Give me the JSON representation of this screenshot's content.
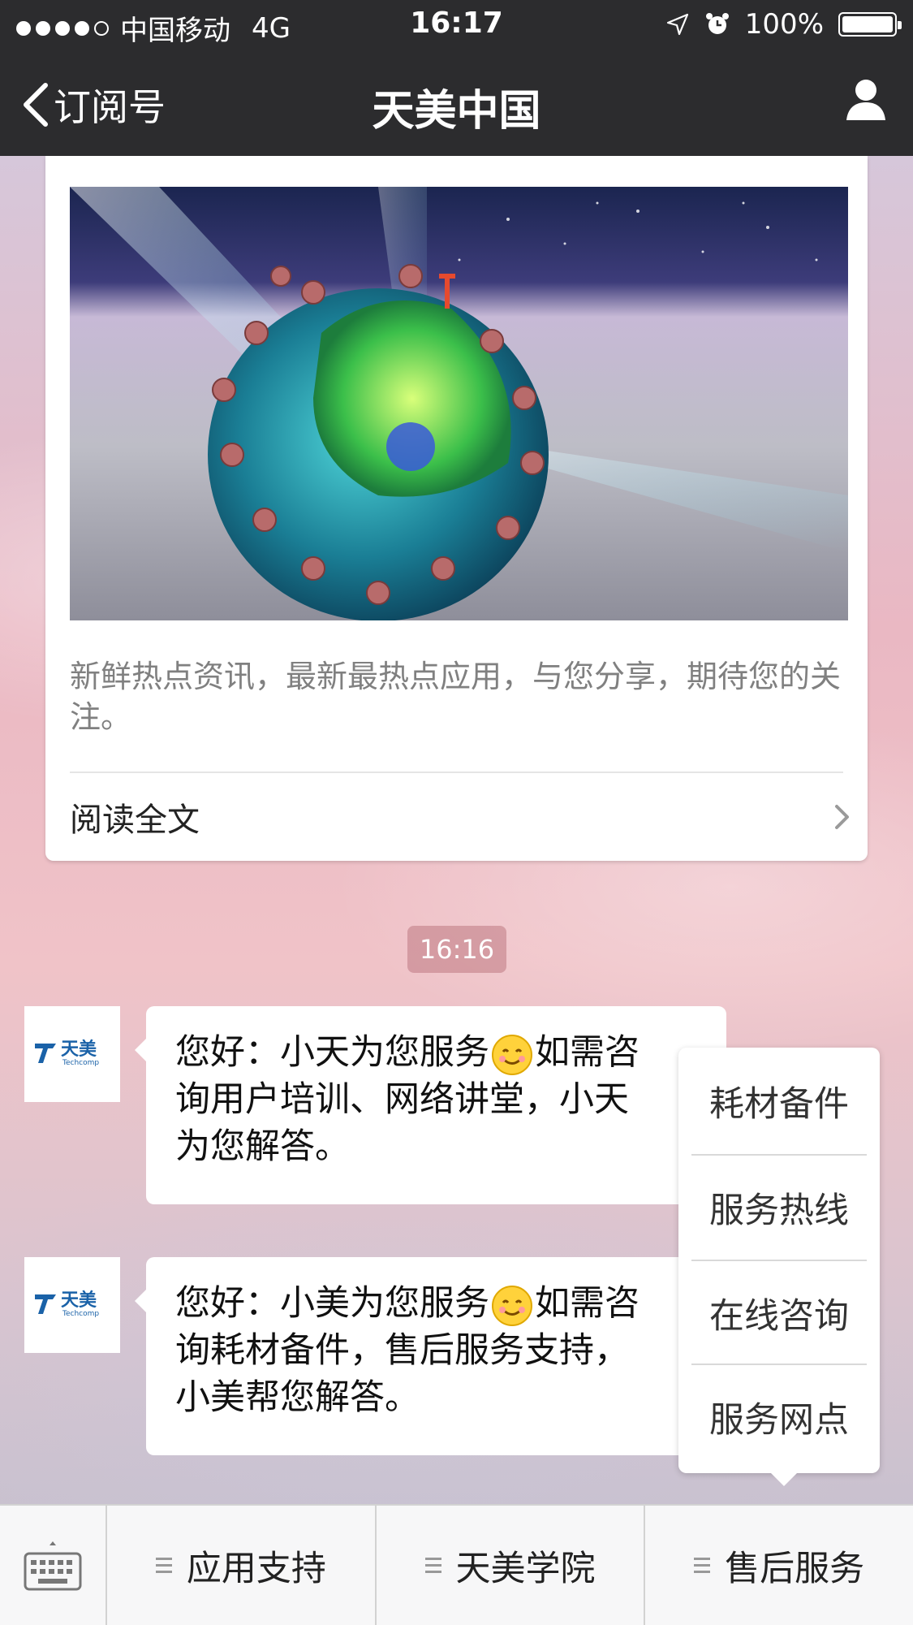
{
  "status_bar": {
    "carrier": "中国移动",
    "network": "4G",
    "time": "16:17",
    "battery": "100%"
  },
  "nav": {
    "back_label": "订阅号",
    "title": "天美中国"
  },
  "article": {
    "description": "新鲜热点资讯，最新最热点应用，与您分享，期待您的关注。",
    "read_more": "阅读全文"
  },
  "chat": {
    "timestamp": "16:16",
    "messages": [
      {
        "line1": "您好：小天为您服务",
        "line1_tail": "如需咨",
        "line2": "询用户培训、网络讲堂，小天",
        "line3": "为您解答。"
      },
      {
        "line1": "您好：小美为您服务",
        "line1_tail": "如需咨",
        "line2": "询耗材备件，售后服务支持，",
        "line3": "小美帮您解答。"
      }
    ],
    "avatar_logo": {
      "cn": "天美",
      "en": "Techcomp"
    }
  },
  "popup_menu": {
    "items": [
      "耗材备件",
      "服务热线",
      "在线咨询",
      "服务网点"
    ]
  },
  "bottom_menu": {
    "tabs": [
      "应用支持",
      "天美学院",
      "售后服务"
    ]
  }
}
